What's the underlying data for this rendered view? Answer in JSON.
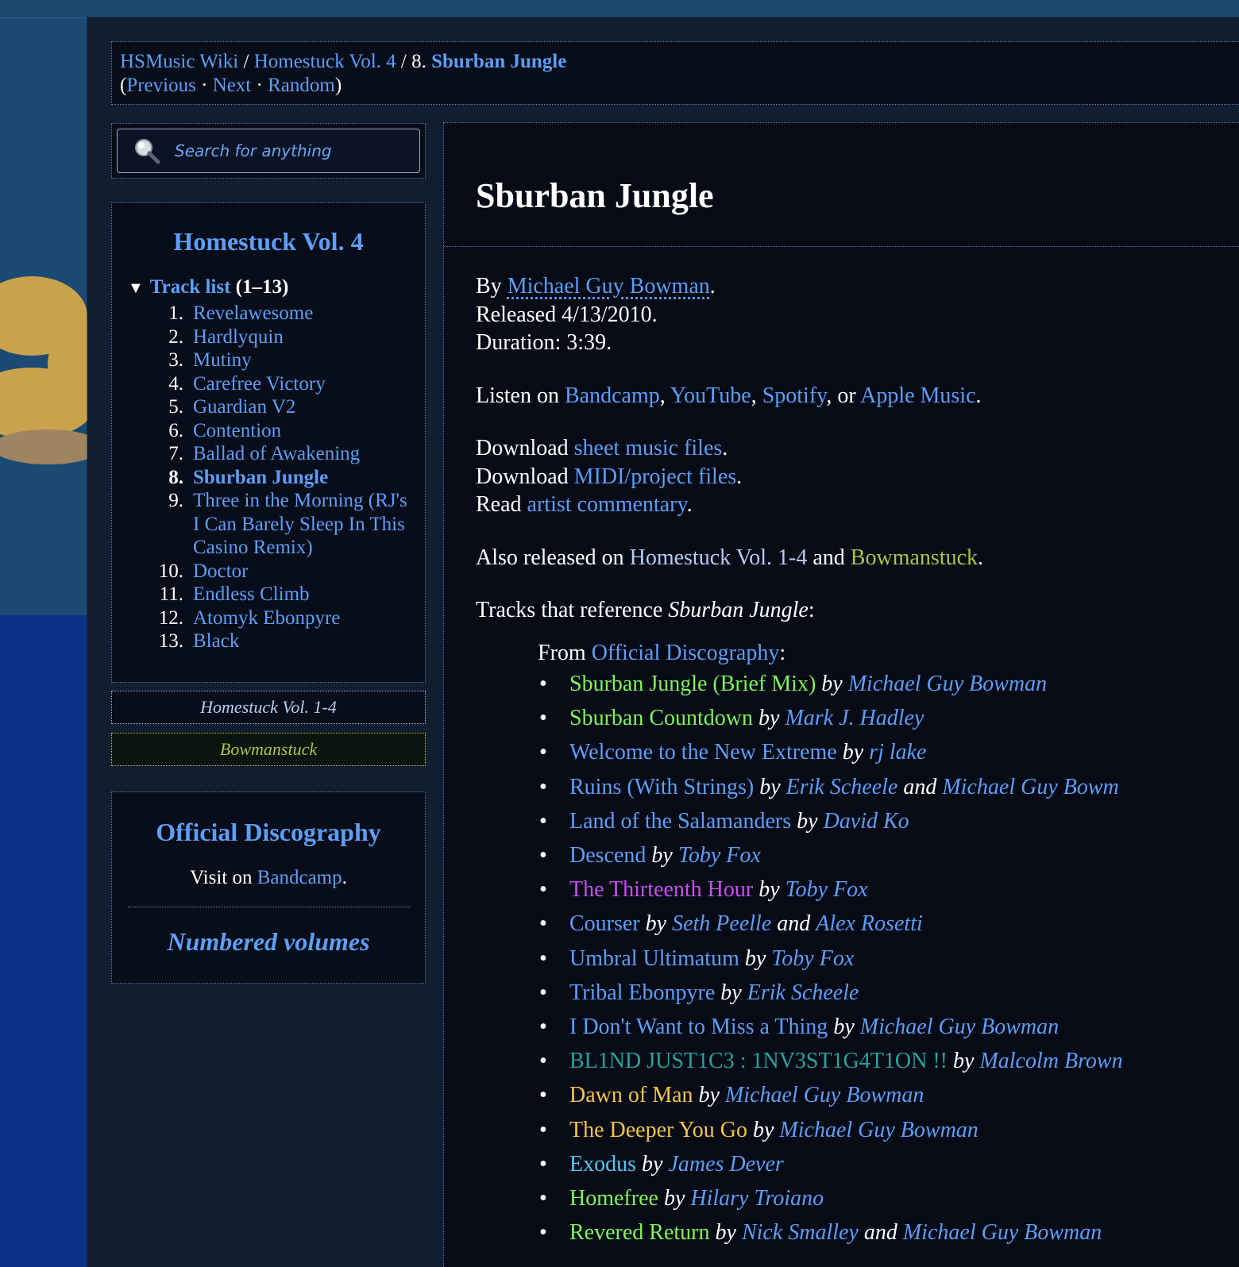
{
  "nav": {
    "crumb_home": "HSMusic Wiki",
    "sep1": " / ",
    "crumb_album": "Homestuck Vol. 4",
    "sep2": " / 8. ",
    "crumb_track": "Sburban Jungle",
    "open_paren": "(",
    "previous": "Previous",
    "dot1": " · ",
    "next": "Next",
    "dot2": " · ",
    "random": "Random",
    "close_paren": ")"
  },
  "search": {
    "placeholder": "Search for anything"
  },
  "album": {
    "title": "Homestuck Vol. 4",
    "tracklist_label": "Track list",
    "tracklist_range": "(1–13)",
    "tracks": [
      {
        "num": "1.",
        "name": "Revelawesome"
      },
      {
        "num": "2.",
        "name": "Hardlyquin"
      },
      {
        "num": "3.",
        "name": "Mutiny"
      },
      {
        "num": "4.",
        "name": "Carefree Victory"
      },
      {
        "num": "5.",
        "name": "Guardian V2"
      },
      {
        "num": "6.",
        "name": "Contention"
      },
      {
        "num": "7.",
        "name": "Ballad of Awakening"
      },
      {
        "num": "8.",
        "name": "Sburban Jungle"
      },
      {
        "num": "9.",
        "name": "Three in the Morning (RJ's I Can Barely Sleep In This Casino Remix)"
      },
      {
        "num": "10.",
        "name": "Doctor"
      },
      {
        "num": "11.",
        "name": "Endless Climb"
      },
      {
        "num": "12.",
        "name": "Atomyk Ebonpyre"
      },
      {
        "num": "13.",
        "name": "Black"
      }
    ]
  },
  "chips": {
    "vol14": "Homestuck Vol. 1-4",
    "bowman": "Bowmanstuck"
  },
  "group": {
    "title": "Official Discography",
    "visit_prefix": "Visit on ",
    "visit_link": "Bandcamp",
    "visit_suffix": ".",
    "numbered": "Numbered volumes"
  },
  "main": {
    "title": "Sburban Jungle",
    "by_prefix": "By ",
    "artist": "Michael Guy Bowman",
    "by_suffix": ".",
    "released": "Released 4/13/2010.",
    "duration": "Duration: 3:39.",
    "listen_prefix": "Listen on ",
    "listen_bandcamp": "Bandcamp",
    "listen_sep1": ", ",
    "listen_youtube": "YouTube",
    "listen_sep2": ", ",
    "listen_spotify": "Spotify",
    "listen_sep3": ", or ",
    "listen_apple": "Apple Music",
    "listen_suffix": ".",
    "download_prefix": "Download ",
    "download_sheet": "sheet music files",
    "download_midi": "MIDI/project files",
    "period": ".",
    "read_prefix": "Read ",
    "read_link": "artist commentary",
    "also_prefix": "Also released on ",
    "also_vol14": "Homestuck Vol. 1-4",
    "also_and": " and ",
    "also_bowman": "Bowmanstuck",
    "refs_prefix": "Tracks that reference ",
    "refs_title": "Sburban Jungle",
    "refs_suffix": ":",
    "from_prefix": "From ",
    "from_link": "Official Discography",
    "from_suffix": ":"
  },
  "references": [
    {
      "title": "Sburban Jungle (Brief Mix)",
      "color": "#7ff55a",
      "artists": [
        "Michael Guy Bowman"
      ]
    },
    {
      "title": "Sburban Countdown",
      "color": "#7ff55a",
      "artists": [
        "Mark J. Hadley"
      ]
    },
    {
      "title": "Welcome to the New Extreme",
      "color": "#5e9ef7",
      "artists": [
        "rj lake"
      ]
    },
    {
      "title": "Ruins (With Strings)",
      "color": "#5e9ef7",
      "artists": [
        "Erik Scheele",
        "Michael Guy Bowm"
      ]
    },
    {
      "title": "Land of the Salamanders",
      "color": "#5e9ef7",
      "artists": [
        "David Ko"
      ]
    },
    {
      "title": "Descend",
      "color": "#5e9ef7",
      "artists": [
        "Toby Fox"
      ]
    },
    {
      "title": "The Thirteenth Hour",
      "color": "#c74ff0",
      "artists": [
        "Toby Fox"
      ]
    },
    {
      "title": "Courser",
      "color": "#5e9ef7",
      "artists": [
        "Seth Peelle",
        "Alex Rosetti"
      ]
    },
    {
      "title": "Umbral Ultimatum",
      "color": "#5e9ef7",
      "artists": [
        "Toby Fox"
      ]
    },
    {
      "title": "Tribal Ebonpyre",
      "color": "#5e9ef7",
      "artists": [
        "Erik Scheele"
      ]
    },
    {
      "title": "I Don't Want to Miss a Thing",
      "color": "#5e9ef7",
      "artists": [
        "Michael Guy Bowman"
      ]
    },
    {
      "title": "BL1ND JUST1C3 : 1NV3ST1G4T1ON !!",
      "color": "#2aa39a",
      "artists": [
        "Malcolm Brown"
      ]
    },
    {
      "title": "Dawn of Man",
      "color": "#f4c54a",
      "artists": [
        "Michael Guy Bowman"
      ]
    },
    {
      "title": "The Deeper You Go",
      "color": "#f4c54a",
      "artists": [
        "Michael Guy Bowman"
      ]
    },
    {
      "title": "Exodus",
      "color": "#54c8f2",
      "artists": [
        "James Dever"
      ]
    },
    {
      "title": "Homefree",
      "color": "#7ff55a",
      "artists": [
        "Hilary Troiano"
      ]
    },
    {
      "title": "Revered Return",
      "color": "#7ff55a",
      "artists": [
        "Nick Smalley",
        "Michael Guy Bowman"
      ]
    }
  ],
  "ref_by": "by",
  "ref_and": "and"
}
